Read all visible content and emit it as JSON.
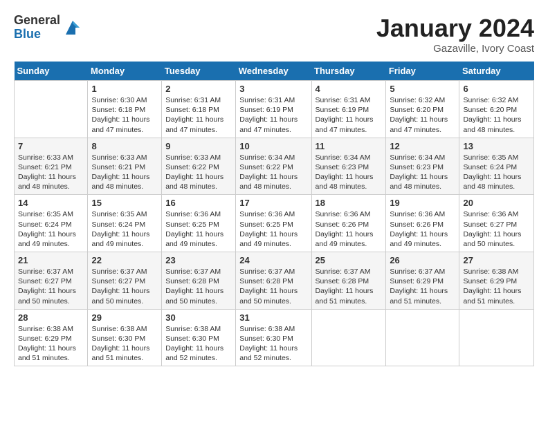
{
  "logo": {
    "general": "General",
    "blue": "Blue"
  },
  "title": "January 2024",
  "location": "Gazaville, Ivory Coast",
  "days_header": [
    "Sunday",
    "Monday",
    "Tuesday",
    "Wednesday",
    "Thursday",
    "Friday",
    "Saturday"
  ],
  "weeks": [
    [
      {
        "day": "",
        "info": ""
      },
      {
        "day": "1",
        "info": "Sunrise: 6:30 AM\nSunset: 6:18 PM\nDaylight: 11 hours\nand 47 minutes."
      },
      {
        "day": "2",
        "info": "Sunrise: 6:31 AM\nSunset: 6:18 PM\nDaylight: 11 hours\nand 47 minutes."
      },
      {
        "day": "3",
        "info": "Sunrise: 6:31 AM\nSunset: 6:19 PM\nDaylight: 11 hours\nand 47 minutes."
      },
      {
        "day": "4",
        "info": "Sunrise: 6:31 AM\nSunset: 6:19 PM\nDaylight: 11 hours\nand 47 minutes."
      },
      {
        "day": "5",
        "info": "Sunrise: 6:32 AM\nSunset: 6:20 PM\nDaylight: 11 hours\nand 47 minutes."
      },
      {
        "day": "6",
        "info": "Sunrise: 6:32 AM\nSunset: 6:20 PM\nDaylight: 11 hours\nand 48 minutes."
      }
    ],
    [
      {
        "day": "7",
        "info": "Sunrise: 6:33 AM\nSunset: 6:21 PM\nDaylight: 11 hours\nand 48 minutes."
      },
      {
        "day": "8",
        "info": "Sunrise: 6:33 AM\nSunset: 6:21 PM\nDaylight: 11 hours\nand 48 minutes."
      },
      {
        "day": "9",
        "info": "Sunrise: 6:33 AM\nSunset: 6:22 PM\nDaylight: 11 hours\nand 48 minutes."
      },
      {
        "day": "10",
        "info": "Sunrise: 6:34 AM\nSunset: 6:22 PM\nDaylight: 11 hours\nand 48 minutes."
      },
      {
        "day": "11",
        "info": "Sunrise: 6:34 AM\nSunset: 6:23 PM\nDaylight: 11 hours\nand 48 minutes."
      },
      {
        "day": "12",
        "info": "Sunrise: 6:34 AM\nSunset: 6:23 PM\nDaylight: 11 hours\nand 48 minutes."
      },
      {
        "day": "13",
        "info": "Sunrise: 6:35 AM\nSunset: 6:24 PM\nDaylight: 11 hours\nand 48 minutes."
      }
    ],
    [
      {
        "day": "14",
        "info": "Sunrise: 6:35 AM\nSunset: 6:24 PM\nDaylight: 11 hours\nand 49 minutes."
      },
      {
        "day": "15",
        "info": "Sunrise: 6:35 AM\nSunset: 6:24 PM\nDaylight: 11 hours\nand 49 minutes."
      },
      {
        "day": "16",
        "info": "Sunrise: 6:36 AM\nSunset: 6:25 PM\nDaylight: 11 hours\nand 49 minutes."
      },
      {
        "day": "17",
        "info": "Sunrise: 6:36 AM\nSunset: 6:25 PM\nDaylight: 11 hours\nand 49 minutes."
      },
      {
        "day": "18",
        "info": "Sunrise: 6:36 AM\nSunset: 6:26 PM\nDaylight: 11 hours\nand 49 minutes."
      },
      {
        "day": "19",
        "info": "Sunrise: 6:36 AM\nSunset: 6:26 PM\nDaylight: 11 hours\nand 49 minutes."
      },
      {
        "day": "20",
        "info": "Sunrise: 6:36 AM\nSunset: 6:27 PM\nDaylight: 11 hours\nand 50 minutes."
      }
    ],
    [
      {
        "day": "21",
        "info": "Sunrise: 6:37 AM\nSunset: 6:27 PM\nDaylight: 11 hours\nand 50 minutes."
      },
      {
        "day": "22",
        "info": "Sunrise: 6:37 AM\nSunset: 6:27 PM\nDaylight: 11 hours\nand 50 minutes."
      },
      {
        "day": "23",
        "info": "Sunrise: 6:37 AM\nSunset: 6:28 PM\nDaylight: 11 hours\nand 50 minutes."
      },
      {
        "day": "24",
        "info": "Sunrise: 6:37 AM\nSunset: 6:28 PM\nDaylight: 11 hours\nand 50 minutes."
      },
      {
        "day": "25",
        "info": "Sunrise: 6:37 AM\nSunset: 6:28 PM\nDaylight: 11 hours\nand 51 minutes."
      },
      {
        "day": "26",
        "info": "Sunrise: 6:37 AM\nSunset: 6:29 PM\nDaylight: 11 hours\nand 51 minutes."
      },
      {
        "day": "27",
        "info": "Sunrise: 6:38 AM\nSunset: 6:29 PM\nDaylight: 11 hours\nand 51 minutes."
      }
    ],
    [
      {
        "day": "28",
        "info": "Sunrise: 6:38 AM\nSunset: 6:29 PM\nDaylight: 11 hours\nand 51 minutes."
      },
      {
        "day": "29",
        "info": "Sunrise: 6:38 AM\nSunset: 6:30 PM\nDaylight: 11 hours\nand 51 minutes."
      },
      {
        "day": "30",
        "info": "Sunrise: 6:38 AM\nSunset: 6:30 PM\nDaylight: 11 hours\nand 52 minutes."
      },
      {
        "day": "31",
        "info": "Sunrise: 6:38 AM\nSunset: 6:30 PM\nDaylight: 11 hours\nand 52 minutes."
      },
      {
        "day": "",
        "info": ""
      },
      {
        "day": "",
        "info": ""
      },
      {
        "day": "",
        "info": ""
      }
    ]
  ]
}
